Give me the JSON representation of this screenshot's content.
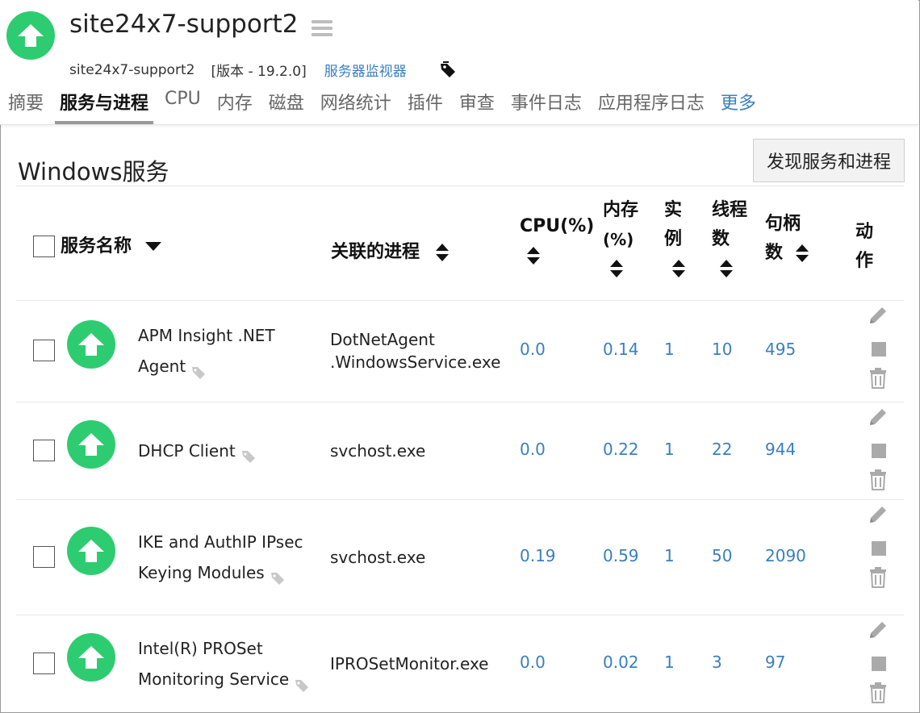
{
  "header": {
    "title": "site24x7-support2",
    "monitor_name": "site24x7-support2",
    "version": "[版本 - 19.2.0]",
    "monitor_type": "服务器监视器"
  },
  "tabs": [
    "摘要",
    "服务与进程",
    "CPU",
    "内存",
    "磁盘",
    "网络统计",
    "插件",
    "审查",
    "事件日志",
    "应用程序日志",
    "更多"
  ],
  "active_tab": "服务与进程",
  "section": {
    "title": "Windows服务",
    "discover_button": "发现服务和进程"
  },
  "table": {
    "columns": {
      "service_name": "服务名称",
      "process": "关联的进程",
      "cpu": "CPU(%)",
      "memory_1": "内存",
      "memory_2": "(%)",
      "instances_1": "实",
      "instances_2": "例",
      "threads_1": "线程",
      "threads_2": "数",
      "handles_1": "句柄",
      "handles_2": "数",
      "action_1": "动",
      "action_2": "作"
    },
    "rows": [
      {
        "name": "APM Insight .NET Agent",
        "process": "DotNetAgent .WindowsService.exe",
        "cpu": "0.0",
        "memory": "0.14",
        "instances": "1",
        "threads": "10",
        "handles": "495"
      },
      {
        "name": "DHCP Client",
        "process": "svchost.exe",
        "cpu": "0.0",
        "memory": "0.22",
        "instances": "1",
        "threads": "22",
        "handles": "944"
      },
      {
        "name": "IKE and AuthIP IPsec Keying Modules",
        "process": "svchost.exe",
        "cpu": "0.19",
        "memory": "0.59",
        "instances": "1",
        "threads": "50",
        "handles": "2090"
      },
      {
        "name": "Intel(R) PROSet Monitoring Service",
        "process": "IPROSetMonitor.exe",
        "cpu": "0.0",
        "memory": "0.02",
        "instances": "1",
        "threads": "3",
        "handles": "97"
      }
    ]
  },
  "colors": {
    "up": "#2ecc71",
    "link": "#3a7fbf",
    "icon_gray": "#aaaaaa"
  }
}
